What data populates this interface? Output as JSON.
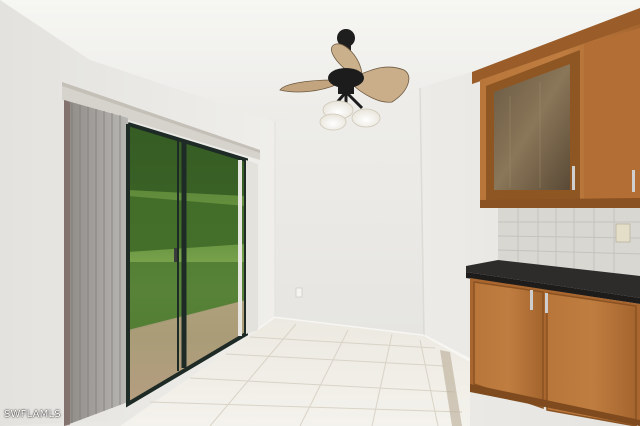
{
  "photo": {
    "watermark": "SWFLAMLS"
  },
  "colors": {
    "wall": "#ecebe7",
    "ceiling": "#f3f3f0",
    "floor_tile": "#efece4",
    "grout": "#d8d2c6",
    "cabinet_wood": "#b06d33",
    "cabinet_wood_dark": "#8a5222",
    "countertop": "#2e2d2c",
    "backsplash_tile": "#d9d8d3",
    "fan_blade": "#c9ad88",
    "fan_body": "#222222",
    "door_frame": "#1d2a26",
    "foliage": "#5f8a3c",
    "blinds": "#a9a7a2"
  },
  "icons": [
    "ceiling-fan-icon",
    "sliding-door-icon",
    "cabinet-icon"
  ]
}
